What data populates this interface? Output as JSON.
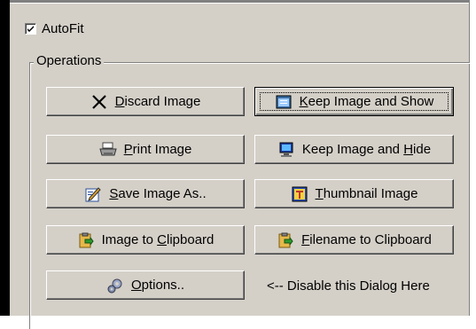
{
  "autofit": {
    "label": "AutoFit",
    "checked": true
  },
  "operations": {
    "title": "Operations",
    "buttons": [
      {
        "label": "Discard Image",
        "underline": "D",
        "icon": "close-x-icon"
      },
      {
        "label": "Keep Image and Show",
        "underline": "K",
        "icon": "window-icon"
      },
      {
        "label": "Print Image",
        "underline": "P",
        "icon": "printer-icon"
      },
      {
        "label": "Keep Image and Hide",
        "underline": "H",
        "icon": "monitor-icon"
      },
      {
        "label": "Save Image As..",
        "underline": "S",
        "icon": "edit-pencil-icon"
      },
      {
        "label": "Thumbnail Image",
        "underline": "T",
        "icon": "thumbnail-icon"
      },
      {
        "label": "Image to Clipboard",
        "underline": "C",
        "icon": "clipboard-icon"
      },
      {
        "label": "Filename to Clipboard",
        "underline": "F",
        "icon": "clipboard-icon"
      },
      {
        "label": "Options..",
        "underline": "O",
        "icon": "gears-icon"
      }
    ],
    "disable_hint": "<-- Disable this Dialog Here"
  }
}
